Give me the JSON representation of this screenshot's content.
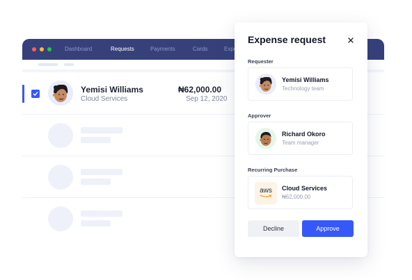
{
  "window": {
    "nav": [
      "Dashboard",
      "Requests",
      "Payments",
      "Cards",
      "Expe"
    ],
    "active_nav": "Requests"
  },
  "selected_row": {
    "name": "Yemisi Williams",
    "subtitle": "Cloud Services",
    "amount": "₦62,000.00",
    "date": "Sep 12, 2020",
    "checked": true
  },
  "modal": {
    "title": "Expense request",
    "close_icon": "close-icon",
    "requester": {
      "label": "Requester",
      "name": "Yemisi Williams",
      "subtitle": "Technology team"
    },
    "approver": {
      "label": "Approver",
      "name": "Richard Okoro",
      "subtitle": "Team manager"
    },
    "purchase": {
      "label": "Recurring Purchase",
      "logo_text": "aws",
      "name": "Cloud Services",
      "amount": "₦62,000.00"
    },
    "decline_label": "Decline",
    "approve_label": "Approve"
  },
  "colors": {
    "titlebar": "#36417a",
    "accent": "#3758f9",
    "skeleton": "#eef1fa"
  }
}
